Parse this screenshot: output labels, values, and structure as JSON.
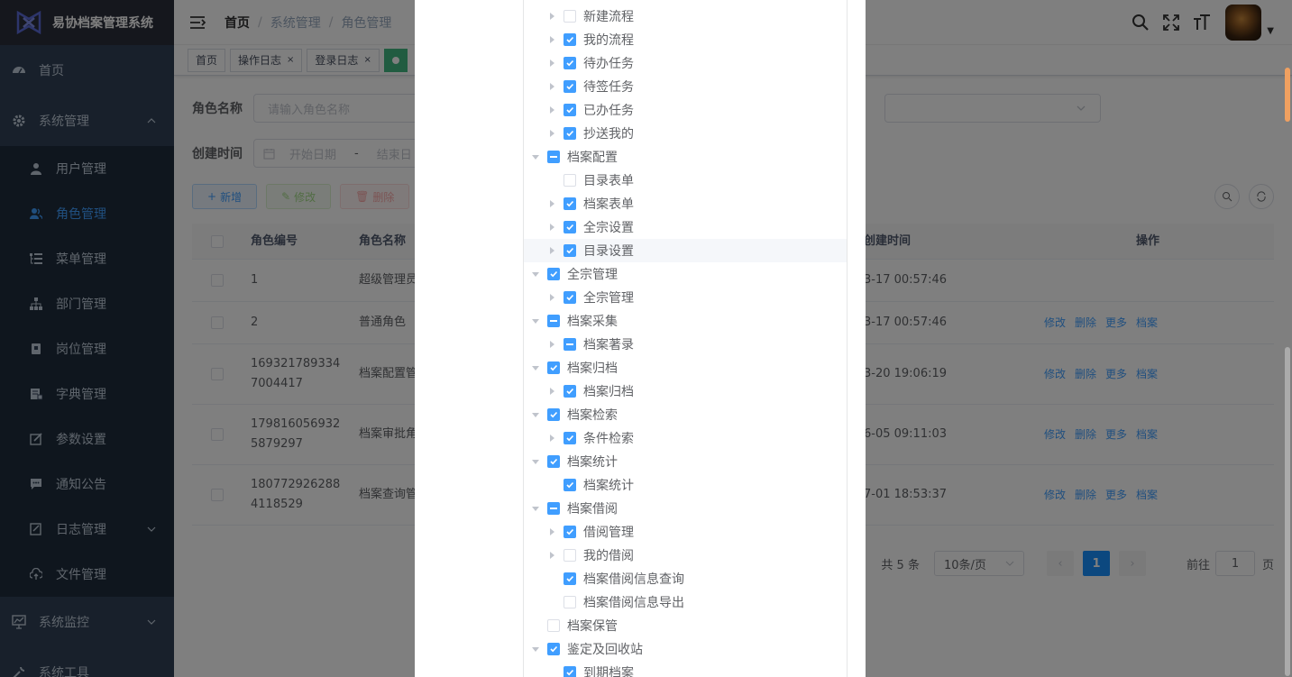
{
  "app": {
    "title": "易协档案管理系统"
  },
  "sidebar": {
    "items": [
      {
        "label": "首页",
        "icon": "dashboard-icon"
      },
      {
        "label": "系统管理",
        "icon": "gear-icon",
        "expanded": true
      }
    ],
    "system_sub": [
      {
        "label": "用户管理",
        "icon": "user-icon"
      },
      {
        "label": "角色管理",
        "icon": "peoples-icon",
        "active": true
      },
      {
        "label": "菜单管理",
        "icon": "tree-table-icon"
      },
      {
        "label": "部门管理",
        "icon": "tree-icon"
      },
      {
        "label": "岗位管理",
        "icon": "post-icon"
      },
      {
        "label": "字典管理",
        "icon": "dict-icon"
      },
      {
        "label": "参数设置",
        "icon": "edit-icon"
      },
      {
        "label": "通知公告",
        "icon": "message-icon"
      },
      {
        "label": "日志管理",
        "icon": "log-icon"
      },
      {
        "label": "文件管理",
        "icon": "upload-icon"
      }
    ],
    "more": [
      {
        "label": "系统监控",
        "icon": "monitor-icon"
      },
      {
        "label": "系统工具",
        "icon": "tool-icon"
      }
    ]
  },
  "navbar": {
    "breadcrumb": [
      "首页",
      "系统管理",
      "角色管理"
    ]
  },
  "tags": [
    {
      "label": "首页",
      "closable": false
    },
    {
      "label": "操作日志",
      "closable": true
    },
    {
      "label": "登录日志",
      "closable": true
    }
  ],
  "search": {
    "role_name_label": "角色名称",
    "role_name_placeholder": "请输入角色名称",
    "create_time_label": "创建时间",
    "start_placeholder": "开始日期",
    "range_sep": "-",
    "end_placeholder": "结束日"
  },
  "toolbar": {
    "add": "新增",
    "edit": "修改",
    "delete": "删除"
  },
  "table": {
    "headers": {
      "id": "角色编号",
      "name": "角色名称",
      "time": "创建时间",
      "ops": "操作"
    },
    "rows": [
      {
        "id": "1",
        "name": "超级管理员",
        "time": "3-17 00:57:46"
      },
      {
        "id": "2",
        "name": "普通角色",
        "time": "3-17 00:57:46"
      },
      {
        "id": "1693217893347004417",
        "id_l1": "169321789334",
        "id_l2": "7004417",
        "name": "档案配置管",
        "time": "3-20 19:06:19"
      },
      {
        "id": "1798160569325879297",
        "id_l1": "179816056932",
        "id_l2": "5879297",
        "name": "档案审批角",
        "time": "6-05 09:11:03"
      },
      {
        "id": "1807729262884118529",
        "id_l1": "180772926288",
        "id_l2": "4118529",
        "name": "档案查询管",
        "time": "7-01 18:53:37"
      }
    ],
    "actions": [
      "修改",
      "删除",
      "更多",
      "档案"
    ]
  },
  "pagination": {
    "total": "共 5 条",
    "page_size": "10条/页",
    "current": "1",
    "goto": "前往",
    "goto_value": "1",
    "page_unit": "页"
  },
  "tree_nodes": [
    {
      "label": "新建流程",
      "level": 1,
      "state": "unchecked",
      "arrow": "right"
    },
    {
      "label": "我的流程",
      "level": 1,
      "state": "checked",
      "arrow": "right"
    },
    {
      "label": "待办任务",
      "level": 1,
      "state": "checked",
      "arrow": "right"
    },
    {
      "label": "待签任务",
      "level": 1,
      "state": "checked",
      "arrow": "right"
    },
    {
      "label": "已办任务",
      "level": 1,
      "state": "checked",
      "arrow": "right"
    },
    {
      "label": "抄送我的",
      "level": 1,
      "state": "checked",
      "arrow": "right"
    },
    {
      "label": "档案配置",
      "level": 0,
      "state": "indeterminate",
      "arrow": "down"
    },
    {
      "label": "目录表单",
      "level": 1,
      "state": "unchecked",
      "arrow": "none"
    },
    {
      "label": "档案表单",
      "level": 1,
      "state": "checked",
      "arrow": "right"
    },
    {
      "label": "全宗设置",
      "level": 1,
      "state": "checked",
      "arrow": "right"
    },
    {
      "label": "目录设置",
      "level": 1,
      "state": "checked",
      "arrow": "right",
      "highlight": true
    },
    {
      "label": "全宗管理",
      "level": 0,
      "state": "checked",
      "arrow": "down"
    },
    {
      "label": "全宗管理",
      "level": 1,
      "state": "checked",
      "arrow": "right"
    },
    {
      "label": "档案采集",
      "level": 0,
      "state": "indeterminate",
      "arrow": "down"
    },
    {
      "label": "档案著录",
      "level": 1,
      "state": "indeterminate",
      "arrow": "right"
    },
    {
      "label": "档案归档",
      "level": 0,
      "state": "checked",
      "arrow": "down"
    },
    {
      "label": "档案归档",
      "level": 1,
      "state": "checked",
      "arrow": "right"
    },
    {
      "label": "档案检索",
      "level": 0,
      "state": "checked",
      "arrow": "down"
    },
    {
      "label": "条件检索",
      "level": 1,
      "state": "checked",
      "arrow": "right"
    },
    {
      "label": "档案统计",
      "level": 0,
      "state": "checked",
      "arrow": "down"
    },
    {
      "label": "档案统计",
      "level": 1,
      "state": "checked",
      "arrow": "none"
    },
    {
      "label": "档案借阅",
      "level": 0,
      "state": "indeterminate",
      "arrow": "down"
    },
    {
      "label": "借阅管理",
      "level": 1,
      "state": "checked",
      "arrow": "right"
    },
    {
      "label": "我的借阅",
      "level": 1,
      "state": "unchecked",
      "arrow": "right"
    },
    {
      "label": "档案借阅信息查询",
      "level": 1,
      "state": "checked",
      "arrow": "none"
    },
    {
      "label": "档案借阅信息导出",
      "level": 1,
      "state": "unchecked",
      "arrow": "none"
    },
    {
      "label": "档案保管",
      "level": 0,
      "state": "unchecked",
      "arrow": "none"
    },
    {
      "label": "鉴定及回收站",
      "level": 0,
      "state": "checked",
      "arrow": "down"
    },
    {
      "label": "到期档案",
      "level": 1,
      "state": "checked",
      "arrow": "none"
    }
  ],
  "colors": {
    "primary": "#409eff",
    "sidebar_bg": "#304156",
    "submenu_bg": "#1f2d3d",
    "overlay": "rgba(0,0,0,0.5)"
  }
}
